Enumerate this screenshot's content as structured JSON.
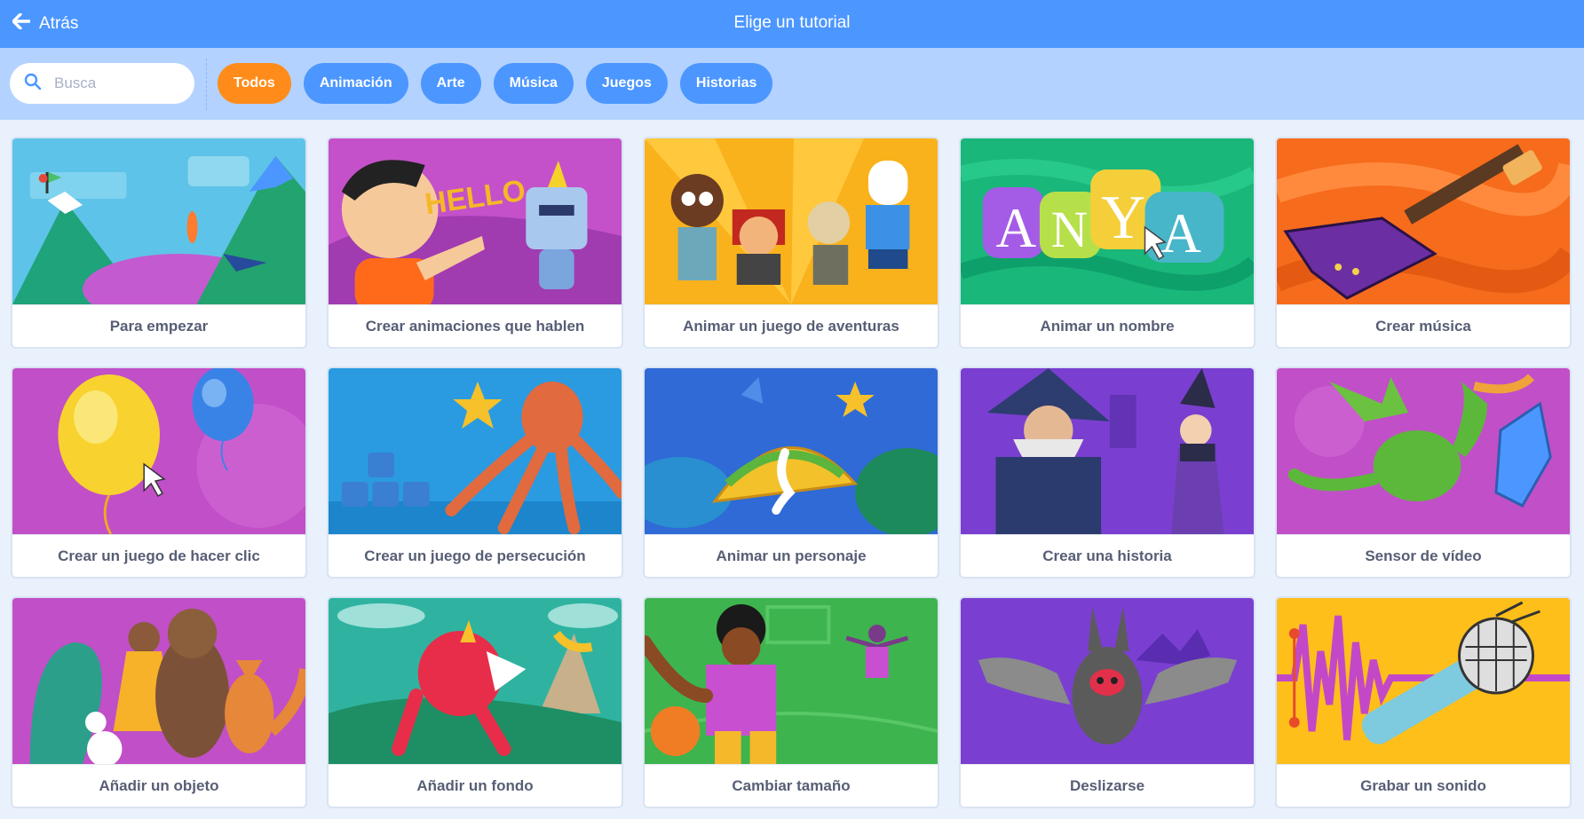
{
  "header": {
    "back_label": "Atrás",
    "title": "Elige un tutorial"
  },
  "search": {
    "placeholder": "Busca",
    "value": ""
  },
  "tags": [
    {
      "label": "Todos",
      "active": true
    },
    {
      "label": "Animación",
      "active": false
    },
    {
      "label": "Arte",
      "active": false
    },
    {
      "label": "Música",
      "active": false
    },
    {
      "label": "Juegos",
      "active": false
    },
    {
      "label": "Historias",
      "active": false
    }
  ],
  "tutorials": [
    {
      "title": "Para empezar",
      "art": "mountains"
    },
    {
      "title": "Crear animaciones que hablen",
      "art": "hello"
    },
    {
      "title": "Animar un juego de aventuras",
      "art": "adventure"
    },
    {
      "title": "Animar un nombre",
      "art": "name"
    },
    {
      "title": "Crear música",
      "art": "guitar"
    },
    {
      "title": "Crear un juego de hacer clic",
      "art": "balloons"
    },
    {
      "title": "Crear un juego de persecución",
      "art": "octopus"
    },
    {
      "title": "Animar un personaje",
      "art": "taco"
    },
    {
      "title": "Crear una historia",
      "art": "wizard"
    },
    {
      "title": "Sensor de vídeo",
      "art": "dragon"
    },
    {
      "title": "Añadir un objeto",
      "art": "animals"
    },
    {
      "title": "Añadir un fondo",
      "art": "dino"
    },
    {
      "title": "Cambiar tamaño",
      "art": "basketball"
    },
    {
      "title": "Deslizarse",
      "art": "bat"
    },
    {
      "title": "Grabar un sonido",
      "art": "microphone"
    }
  ],
  "thumbnail_text": {
    "hello": "HELLO",
    "name": [
      "A",
      "N",
      "Y",
      "A"
    ]
  },
  "colors": {
    "header": "#4c97ff",
    "filterbar": "#b3d2ff",
    "tag": "#4c97ff",
    "tag_active": "#ff8c1a",
    "page": "#e9f1fc"
  }
}
